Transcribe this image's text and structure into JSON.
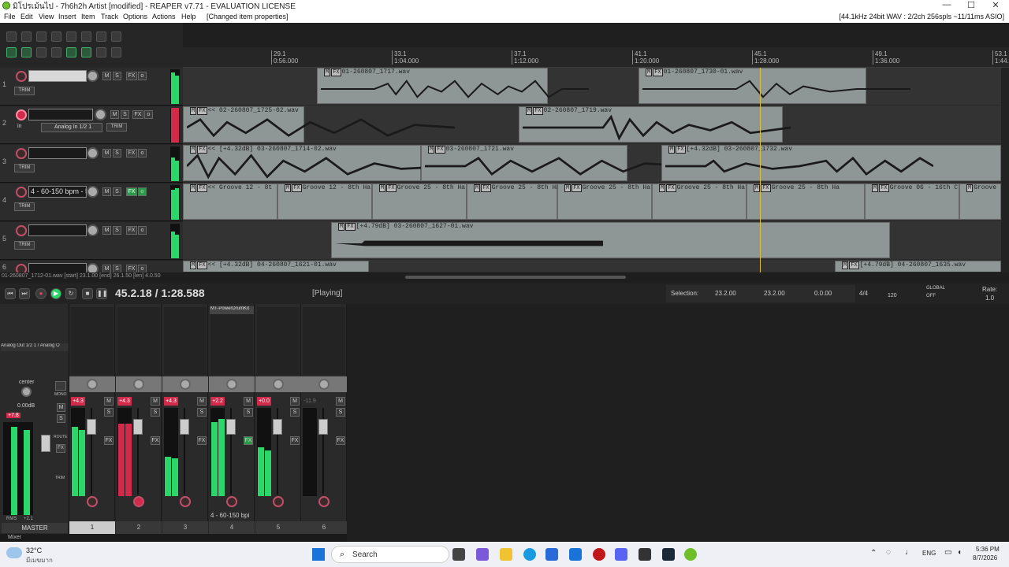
{
  "window": {
    "title": "มิโปรเม้นไป - 7h6h2h Artist [modified] - REAPER v7.71 - EVALUATION LICENSE",
    "min": "—",
    "max": "☐",
    "close": "✕"
  },
  "menu": {
    "items": [
      "File",
      "Edit",
      "View",
      "Insert",
      "Item",
      "Track",
      "Options",
      "Actions",
      "Help",
      "[Changed item properties]"
    ],
    "status": "[44.1kHz 24bit WAV : 2/2ch 256spls ~11/11ms ASIO]"
  },
  "ruler": {
    "marks": [
      {
        "bar": "29.1",
        "time": "0:56.000"
      },
      {
        "bar": "33.1",
        "time": "1:04.000"
      },
      {
        "bar": "37.1",
        "time": "1:12.000"
      },
      {
        "bar": "41.1",
        "time": "1:20.000"
      },
      {
        "bar": "45.1",
        "time": "1:28.000"
      },
      {
        "bar": "49.1",
        "time": "1:36.000"
      },
      {
        "bar": "53.1",
        "time": "1:44.000"
      }
    ]
  },
  "tracks": [
    {
      "num": "1",
      "name": "",
      "input": "",
      "armed": false,
      "trim": "TRIM"
    },
    {
      "num": "2",
      "name": "",
      "input": "Analog In 1/2 1",
      "in_label": "in",
      "armed": true,
      "trim": "TRIM"
    },
    {
      "num": "3",
      "name": "",
      "input": "",
      "armed": false,
      "trim": "TRIM"
    },
    {
      "num": "4",
      "name": "4 - 60-150 bpm - 5",
      "input": "",
      "armed": false,
      "trim": "TRIM"
    },
    {
      "num": "5",
      "name": "",
      "input": "",
      "armed": false,
      "trim": "TRIM"
    },
    {
      "num": "6",
      "name": "",
      "input": "",
      "armed": false,
      "trim": "TRIM"
    }
  ],
  "track_buttons": {
    "m": "M",
    "s": "S",
    "fx": "FX"
  },
  "items": {
    "lane1": [
      "01-260807_1717.wav",
      "01-260807_1730-01.wav"
    ],
    "lane2": [
      "<< 02-260807_1725-02.wav",
      "02-260807_1719.wav"
    ],
    "lane3": [
      "<< [+4.32dB] 03-260807_1714-02.wav",
      "03-260807_1721.wav",
      "[+4.32dB] 03-260807_1732.wav"
    ],
    "lane4": [
      "<< Groove 12 - 8t",
      "Groove 12 - 8th Ha",
      "Groove 25 - 8th Ha",
      "Groove 25 - 8th Ha",
      "Groove 25 - 8th Ha",
      "Groove 25 - 8th Ha",
      "Groove 25 - 8th Ha",
      "Groove 06 - 16th C",
      "Groove"
    ],
    "lane5": [
      "[+4.79dB] 03-260807_1627-01.wav"
    ],
    "lane6": [
      "<< [+4.32dB] 04-260807_1621-01.wav",
      "[+4.79dB] 04-260807_1635.wav"
    ]
  },
  "item_status": "01-260807_1712-01.wav [start] 23.1.00 [end] 26.1.50 [len] 4.0.50",
  "transport": {
    "position": "45.2.18 / 1:28.588",
    "state": "[Playing]",
    "selection_label": "Selection:",
    "sel_start": "23.2.00",
    "sel_end": "23.2.00",
    "sel_len": "0.0.00",
    "timesig": "4/4",
    "bpm": "120",
    "global": "GLOBAL",
    "global_state": "OFF",
    "rate_label": "Rate:",
    "rate": "1.0"
  },
  "mixer": {
    "out_label": "Analog Out 1/2 1 / Analog O",
    "master_pan": "center",
    "master_vol": "0.00dB",
    "master_peak": "+7.8",
    "master_peak2": "+2.1",
    "master_rms": "RMS",
    "master_label": "MASTER",
    "mono": "MONO",
    "route": "ROUTE",
    "trim": "TRIM",
    "fx_plugin": "MT-PowerDrumKit",
    "strip_label_4": "4 - 60-150 bpi",
    "strips": [
      {
        "num": "1",
        "peak": "+4.3",
        "level": 0.78,
        "armed": false
      },
      {
        "num": "2",
        "peak": "+4.3",
        "level": 0.82,
        "armed": true
      },
      {
        "num": "3",
        "peak": "+4.3",
        "level": 0.45,
        "armed": false
      },
      {
        "num": "4",
        "peak": "+2.2",
        "level": 0.84,
        "armed": false
      },
      {
        "num": "5",
        "peak": "+0.0",
        "level": 0.55,
        "armed": false
      },
      {
        "num": "6",
        "peak": "-11.9",
        "level": 0.0,
        "armed": false
      }
    ],
    "footer": "Mixer"
  },
  "taskbar": {
    "weather_temp": "32°C",
    "weather_desc": "มีเมฆมาก",
    "search": "Search",
    "lang": "ENG",
    "time": "5:36 PM",
    "date": "8/7/2026"
  },
  "colors": {
    "accent_green": "#2bd66b",
    "rec_red": "#d22a4a",
    "item_gray": "#8e9796"
  }
}
